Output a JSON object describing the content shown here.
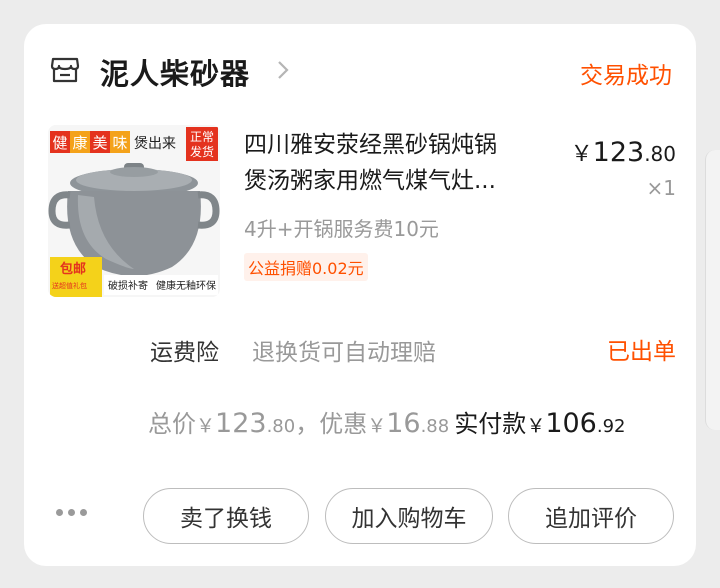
{
  "shop": {
    "name": "泥人柴砂器",
    "status": "交易成功"
  },
  "product": {
    "thumb_texts": {
      "top_banner": [
        "健",
        "康",
        "美",
        "味"
      ],
      "top_after": "煲出来",
      "badge": [
        "正常",
        "发货"
      ],
      "free_ship": "包邮",
      "free_ship_sub": "送超值礼包",
      "bottom_1": "破损补寄",
      "bottom_2": "健康无釉环保"
    },
    "title_line1": "四川雅安荥经黑砂锅炖锅",
    "title_line2": "煲汤粥家用燃气煤气灶...",
    "sku": "4升+开锅服务费10元",
    "charity": "公益捐赠0.02元",
    "price_currency": "￥",
    "price_int": "123",
    "price_dec": ".80",
    "quantity": "×1"
  },
  "insurance": {
    "label": "运费险",
    "desc": "退换货可自动理赔",
    "status": "已出单"
  },
  "totals": {
    "total_label": "总价",
    "total_cur": "￥",
    "total_int": "123",
    "total_dec": ".80",
    "sep": "，",
    "discount_label": "优惠",
    "discount_cur": "￥",
    "discount_int": "16",
    "discount_dec": ".88",
    "paid_label": "实付款",
    "paid_cur": "￥",
    "paid_int": "106",
    "paid_dec": ".92"
  },
  "actions": {
    "sell": "卖了换钱",
    "add_cart": "加入购物车",
    "review": "追加评价"
  },
  "colors": {
    "accent": "#ff5000",
    "text": "#1a1a1a",
    "muted": "#999999"
  }
}
